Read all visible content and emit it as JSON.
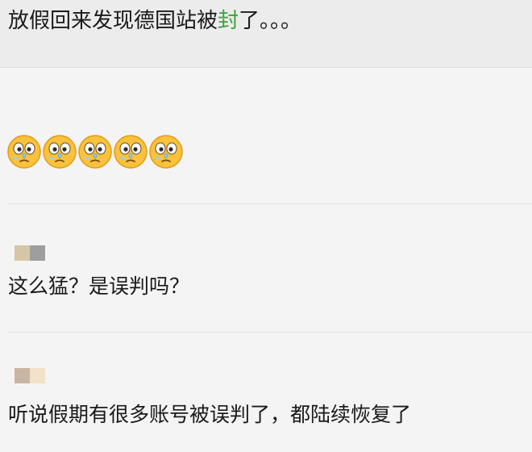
{
  "post": {
    "title_before": "放假回来发现德国站被",
    "title_highlight": "封",
    "title_after": "了。。。",
    "highlight_color": "#3aa33a"
  },
  "reply1": {
    "emoji_icon": "crying-face-emoji",
    "emoji_count": 5
  },
  "reply2": {
    "avatar_colors": [
      "#d6c6a6",
      "#9e9e9e"
    ],
    "text": "这么猛？是误判吗？"
  },
  "reply3": {
    "avatar_colors": [
      "#c9b6a2",
      "#f1e2c8"
    ],
    "text": "听说假期有很多账号被误判了，都陆续恢复了"
  }
}
